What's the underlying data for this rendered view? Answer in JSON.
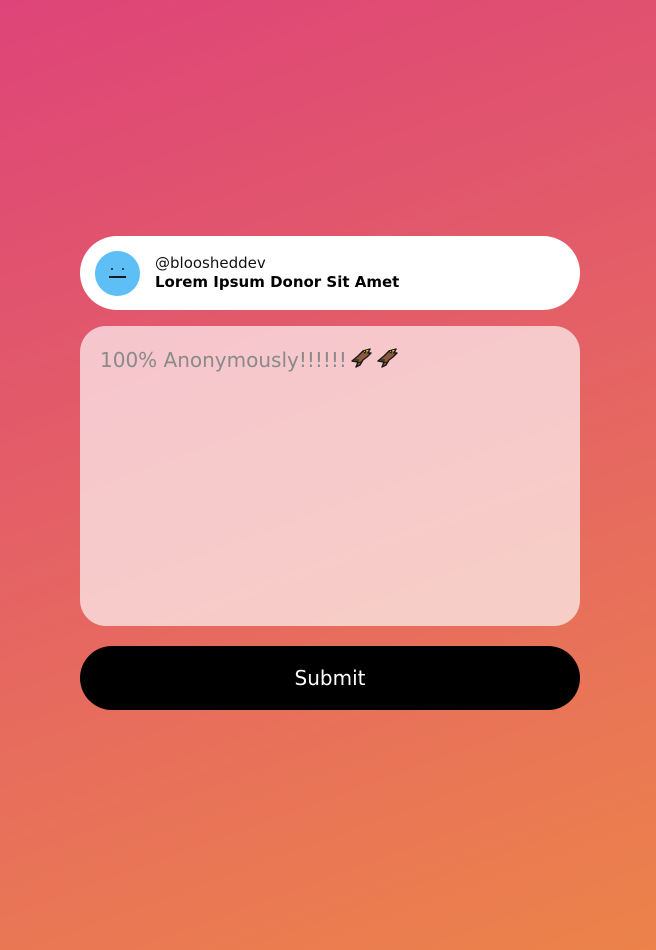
{
  "profile": {
    "username": "@bloosheddev",
    "message_title": "Lorem Ipsum Donor Sit Amet",
    "avatar_icon": "neutral-face-icon",
    "avatar_color": "#5ebff7"
  },
  "message": {
    "placeholder_text": "100% Anonymously!!!!!!",
    "emoji_icons": [
      "eagle-icon",
      "eagle-icon"
    ]
  },
  "submit": {
    "label": "Submit"
  },
  "colors": {
    "gradient_start": "#de4479",
    "gradient_end": "#ec834a",
    "button_bg": "#000000",
    "button_text": "#ffffff"
  }
}
